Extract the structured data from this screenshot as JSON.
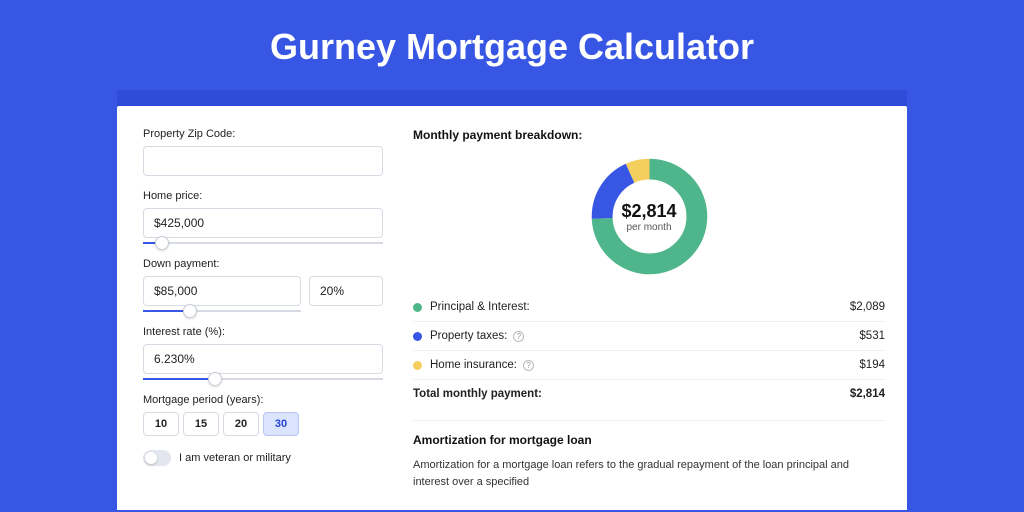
{
  "title": "Gurney Mortgage Calculator",
  "inputs": {
    "zip_label": "Property Zip Code:",
    "zip_value": "",
    "home_price_label": "Home price:",
    "home_price_value": "$425,000",
    "home_price_slider_pct": 8,
    "down_payment_label": "Down payment:",
    "down_payment_value": "$85,000",
    "down_payment_pct": "20%",
    "down_payment_slider_pct": 20,
    "interest_label": "Interest rate (%):",
    "interest_value": "6.230%",
    "interest_slider_pct": 30,
    "period_label": "Mortgage period (years):",
    "periods": [
      "10",
      "15",
      "20",
      "30"
    ],
    "period_selected": "30",
    "veteran_label": "I am veteran or military"
  },
  "breakdown": {
    "title": "Monthly payment breakdown:",
    "center_value": "$2,814",
    "center_sub": "per month",
    "items": [
      {
        "label": "Principal & Interest:",
        "value": "$2,089",
        "color": "#4fb58a",
        "info": false
      },
      {
        "label": "Property taxes:",
        "value": "$531",
        "color": "#3756e4",
        "info": true
      },
      {
        "label": "Home insurance:",
        "value": "$194",
        "color": "#f4cf5e",
        "info": true
      }
    ],
    "total_label": "Total monthly payment:",
    "total_value": "$2,814"
  },
  "chart_data": {
    "type": "pie",
    "title": "Monthly payment breakdown",
    "categories": [
      "Principal & Interest",
      "Property taxes",
      "Home insurance"
    ],
    "values": [
      2089,
      531,
      194
    ],
    "colors": [
      "#4fb58a",
      "#3756e4",
      "#f4cf5e"
    ],
    "total": 2814,
    "unit": "USD per month"
  },
  "amort": {
    "title": "Amortization for mortgage loan",
    "text": "Amortization for a mortgage loan refers to the gradual repayment of the loan principal and interest over a specified"
  }
}
